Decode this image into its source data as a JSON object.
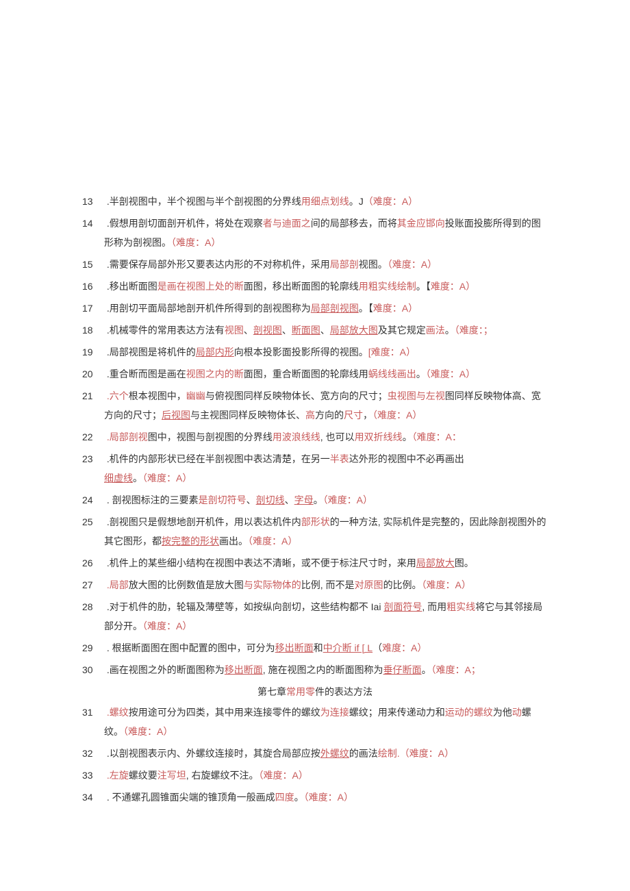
{
  "items": [
    {
      "num": "13",
      "segments": [
        {
          "t": " .半剖视图中，半个视图与半个剖视图的分界线",
          "c": ""
        },
        {
          "t": "用细点划线",
          "c": "red"
        },
        {
          "t": "。J",
          "c": ""
        },
        {
          "t": "（难度：A）",
          "c": "red"
        }
      ]
    },
    {
      "num": "14",
      "segments": [
        {
          "t": " .假想用剖切面剖开机件，将处在观察",
          "c": ""
        },
        {
          "t": "者与迪面之",
          "c": "red"
        },
        {
          "t": "间的局部移去，而将",
          "c": ""
        },
        {
          "t": "其金应邯向",
          "c": "red"
        },
        {
          "t": "投账面投膨所得到的图形称为剖视图。",
          "c": ""
        },
        {
          "t": "（难度：A）",
          "c": "red"
        }
      ]
    },
    {
      "num": "15",
      "segments": [
        {
          "t": " .需要保存局部外形又要表达内形的不对称机件，采用",
          "c": ""
        },
        {
          "t": "局部剖",
          "c": "red"
        },
        {
          "t": "视图。",
          "c": ""
        },
        {
          "t": "（难度：A）",
          "c": "red"
        }
      ]
    },
    {
      "num": "16",
      "segments": [
        {
          "t": " .移出断面图",
          "c": ""
        },
        {
          "t": "是画在视图上处的断",
          "c": "red"
        },
        {
          "t": "面图，移出断面图的轮廓线",
          "c": ""
        },
        {
          "t": "用粗实线绘制",
          "c": "red"
        },
        {
          "t": "。【",
          "c": ""
        },
        {
          "t": "难度：A）",
          "c": "red"
        }
      ]
    },
    {
      "num": "17",
      "segments": [
        {
          "t": " .用剖切平面局部地剖开机件所得到的剖视图称为",
          "c": ""
        },
        {
          "t": "局部剖视图",
          "c": "redlink"
        },
        {
          "t": "。【",
          "c": ""
        },
        {
          "t": "难度：A）",
          "c": "red"
        }
      ]
    },
    {
      "num": "18",
      "segments": [
        {
          "t": " .机械零件的常用表达方法有",
          "c": ""
        },
        {
          "t": "视图",
          "c": "red"
        },
        {
          "t": "、",
          "c": ""
        },
        {
          "t": "剖视图",
          "c": "redlink"
        },
        {
          "t": "、",
          "c": ""
        },
        {
          "t": "断面图",
          "c": "redlink"
        },
        {
          "t": "、",
          "c": ""
        },
        {
          "t": "局部放大图",
          "c": "redlink"
        },
        {
          "t": "及其它规定",
          "c": ""
        },
        {
          "t": "画法",
          "c": "red"
        },
        {
          "t": "。",
          "c": ""
        },
        {
          "t": "（难度：；",
          "c": "red"
        }
      ]
    },
    {
      "num": "19",
      "segments": [
        {
          "t": " .局部视图是将机件的",
          "c": ""
        },
        {
          "t": "局部内形",
          "c": "redlink"
        },
        {
          "t": "向根本投影面投影所得的视图。",
          "c": ""
        },
        {
          "t": "[难度：A）",
          "c": "red"
        }
      ]
    },
    {
      "num": "20",
      "segments": [
        {
          "t": " .重合断而图是画在",
          "c": ""
        },
        {
          "t": "视图之内的断",
          "c": "red"
        },
        {
          "t": "面图，重",
          "c": ""
        },
        {
          "t": "合断面图的轮廓线用",
          "c": ""
        },
        {
          "t": "蜗线线画出",
          "c": "red"
        },
        {
          "t": "。",
          "c": ""
        },
        {
          "t": "（难度：A）",
          "c": "red"
        }
      ]
    },
    {
      "num": "21",
      "segments": [
        {
          "t": " .六个",
          "c": "red"
        },
        {
          "t": "根本视图中，",
          "c": ""
        },
        {
          "t": "幽幽",
          "c": "red"
        },
        {
          "t": "与俯视图同样反映物体长、宽方向的尺寸；",
          "c": ""
        },
        {
          "t": "虫视图与左视",
          "c": "red"
        },
        {
          "t": "图同样反映物体高、宽方向的尺寸；",
          "c": ""
        },
        {
          "t": "后视图",
          "c": "redlink"
        },
        {
          "t": "与主视图同样反映物体长、",
          "c": ""
        },
        {
          "t": "高",
          "c": "red"
        },
        {
          "t": "方向的",
          "c": ""
        },
        {
          "t": "尺寸",
          "c": "red"
        },
        {
          "t": "，",
          "c": ""
        },
        {
          "t": "（难度：A）",
          "c": "red"
        }
      ]
    },
    {
      "num": "22",
      "segments": [
        {
          "t": " .局部剖视",
          "c": "red"
        },
        {
          "t": "图中，视图与剖视图的分界线",
          "c": ""
        },
        {
          "t": "用波浪线线",
          "c": "red"
        },
        {
          "t": ", 也可以",
          "c": ""
        },
        {
          "t": "用双折线线",
          "c": "red"
        },
        {
          "t": "。",
          "c": ""
        },
        {
          "t": "（难度：A：",
          "c": "red"
        }
      ]
    },
    {
      "num": "23",
      "segments": [
        {
          "t": " .机件的内部形状已经在半剖视图中表达清楚，在另一",
          "c": ""
        },
        {
          "t": "半表",
          "c": "red"
        },
        {
          "t": "达外形的视图中不必再画出",
          "c": ""
        },
        {
          "t": "\n",
          "c": ""
        },
        {
          "t": "细虚线",
          "c": "redlink"
        },
        {
          "t": "。",
          "c": ""
        },
        {
          "t": "（难度：A）",
          "c": "red"
        }
      ]
    },
    {
      "num": "24",
      "segments": [
        {
          "t": " . 剖视图标注的三要素",
          "c": ""
        },
        {
          "t": "是剖切符号",
          "c": "red"
        },
        {
          "t": "、",
          "c": ""
        },
        {
          "t": "剖切线",
          "c": "redlink"
        },
        {
          "t": "、",
          "c": ""
        },
        {
          "t": "字母",
          "c": "redlink"
        },
        {
          "t": "。",
          "c": ""
        },
        {
          "t": "（难度：A）",
          "c": "red"
        }
      ]
    },
    {
      "num": "25",
      "segments": [
        {
          "t": " .剖视图只是假想地剖开机件，用以表达机件内",
          "c": ""
        },
        {
          "t": "部形状",
          "c": "red"
        },
        {
          "t": "的一种方法, 实际机件是完整的，因此除剖视图外的其它图形，都",
          "c": ""
        },
        {
          "t": "按完整的形状",
          "c": "redlink"
        },
        {
          "t": "画出。",
          "c": ""
        },
        {
          "t": "（难度：A）",
          "c": "red"
        }
      ]
    },
    {
      "num": "26",
      "segments": [
        {
          "t": " .机件上的某些细小结构在视图中表达不清晰，或不便于标注尺寸时，来用",
          "c": ""
        },
        {
          "t": "局部放大",
          "c": "redlink"
        },
        {
          "t": "图。",
          "c": ""
        }
      ]
    },
    {
      "num": "27",
      "segments": [
        {
          "t": " .局部",
          "c": "red"
        },
        {
          "t": "放大图的比例数值是放大图",
          "c": ""
        },
        {
          "t": "与实际物体的",
          "c": "red"
        },
        {
          "t": "比例, 而不是",
          "c": ""
        },
        {
          "t": "对原图",
          "c": "red"
        },
        {
          "t": "的比例。",
          "c": ""
        },
        {
          "t": "（难度：A）",
          "c": "red"
        }
      ]
    },
    {
      "num": "28",
      "segments": [
        {
          "t": " .对于机件的肋，轮辐及薄壁等，如按纵向剖切，这些结构都不 Iai ",
          "c": ""
        },
        {
          "t": "剖面符号",
          "c": "redlink"
        },
        {
          "t": ", 而用",
          "c": ""
        },
        {
          "t": "粗实线",
          "c": "red"
        },
        {
          "t": "将它与其邻接局部分开。",
          "c": ""
        },
        {
          "t": "（难度：A）",
          "c": "red"
        }
      ]
    },
    {
      "num": "29",
      "segments": [
        {
          "t": " . 根据断面图在图中配置的图中，可分为",
          "c": ""
        },
        {
          "t": "移出断面",
          "c": "redlink"
        },
        {
          "t": "和",
          "c": ""
        },
        {
          "t": "中介断 if [ L",
          "c": "redlink"
        },
        {
          "t": "（",
          "c": ""
        },
        {
          "t": "难度：A）",
          "c": "red"
        }
      ]
    },
    {
      "num": "30",
      "segments": [
        {
          "t": " .画在视图之外的断面图称为",
          "c": ""
        },
        {
          "t": "移出断面",
          "c": "redlink"
        },
        {
          "t": ", 施在视图之内的断面图称为",
          "c": ""
        },
        {
          "t": "垂仔断面",
          "c": "redlink"
        },
        {
          "t": "。",
          "c": ""
        },
        {
          "t": "（难度：A；",
          "c": "red"
        }
      ]
    }
  ],
  "chapter": [
    {
      "t": "第七章",
      "c": ""
    },
    {
      "t": "常用零",
      "c": "red"
    },
    {
      "t": "件的表达方法",
      "c": ""
    }
  ],
  "items2": [
    {
      "num": "31",
      "segments": [
        {
          "t": " .螺纹",
          "c": "red"
        },
        {
          "t": "按用途可分为四类，其中用来连接零件的螺纹",
          "c": ""
        },
        {
          "t": "为连接",
          "c": "red"
        },
        {
          "t": "螺纹；用来传递动力和",
          "c": ""
        },
        {
          "t": "运动的螺纹",
          "c": "red"
        },
        {
          "t": "为他",
          "c": ""
        },
        {
          "t": "动",
          "c": "red"
        },
        {
          "t": "螺纹。",
          "c": ""
        },
        {
          "t": "（难度：A）",
          "c": "red"
        }
      ]
    },
    {
      "num": "32",
      "segments": [
        {
          "t": " .以剖视图表示内、外螺纹连接时，其旋合局部应按",
          "c": ""
        },
        {
          "t": "外螺纹",
          "c": "redlink"
        },
        {
          "t": "的画法",
          "c": ""
        },
        {
          "t": "绘制.",
          "c": "red"
        },
        {
          "t": "（难度：A）",
          "c": "red"
        }
      ]
    },
    {
      "num": "33",
      "segments": [
        {
          "t": " .左旋",
          "c": "red"
        },
        {
          "t": "螺纹要",
          "c": ""
        },
        {
          "t": "注写坦",
          "c": "red"
        },
        {
          "t": ", 右旋螺纹不注。",
          "c": ""
        },
        {
          "t": "（难度：A）",
          "c": "red"
        }
      ]
    },
    {
      "num": "34",
      "segments": [
        {
          "t": " . 不通螺孔圆锥面尖端的锥顶角一般画成",
          "c": ""
        },
        {
          "t": "四度",
          "c": "red"
        },
        {
          "t": "。",
          "c": ""
        },
        {
          "t": "（难度：A）",
          "c": "red"
        }
      ]
    }
  ]
}
